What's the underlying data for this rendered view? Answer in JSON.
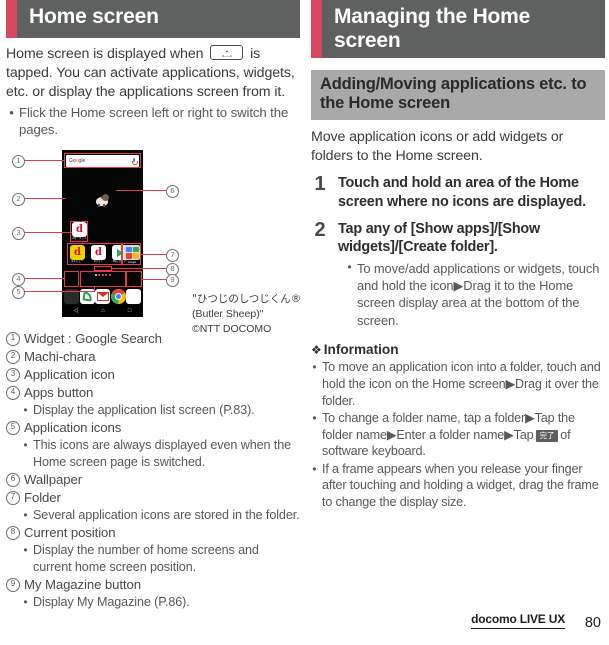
{
  "left": {
    "heading": "Home screen",
    "intro_before_key": "Home screen is displayed when",
    "intro_after_key": "is tapped. You can activate applications, widgets, etc. or display the applications screen from it.",
    "intro_bullet": "Flick the Home screen left or right to switch the pages.",
    "figure": {
      "search_widget_text": "Google",
      "app_icons": [
        {
          "label": "dマーケット",
          "name": "d-market"
        },
        {
          "label": "dメニュー",
          "name": "d-menu"
        },
        {
          "label": "dフォト",
          "name": "d-photo"
        },
        {
          "label": "Play ストア",
          "name": "play-store"
        }
      ],
      "folder_label": "Google",
      "page_dots_total": 5,
      "page_dots_active_index": 0,
      "callout_numbers": [
        "1",
        "2",
        "3",
        "4",
        "5",
        "6",
        "7",
        "8",
        "9"
      ]
    },
    "caption": {
      "line1": "\"ひつじのしつじくん®",
      "line2": "(Butler Sheep)\"",
      "line3": "©NTT DOCOMO"
    },
    "legend": [
      {
        "num": "1",
        "label": "Widget : Google Search",
        "subs": []
      },
      {
        "num": "2",
        "label": "Machi-chara",
        "subs": []
      },
      {
        "num": "3",
        "label": "Application icon",
        "subs": []
      },
      {
        "num": "4",
        "label": "Apps button",
        "subs": [
          "Display the application list screen (P.83)."
        ]
      },
      {
        "num": "5",
        "label": "Application icons",
        "subs": [
          "This icons are always displayed even when the Home screen page is switched."
        ]
      },
      {
        "num": "6",
        "label": "Wallpaper",
        "subs": []
      },
      {
        "num": "7",
        "label": "Folder",
        "subs": [
          "Several application icons are stored in the folder."
        ]
      },
      {
        "num": "8",
        "label": "Current position",
        "subs": [
          "Display the number of home screens and current home screen position."
        ]
      },
      {
        "num": "9",
        "label": "My Magazine button",
        "subs": [
          "Display My Magazine (P.86)."
        ]
      }
    ]
  },
  "right": {
    "heading": "Managing the Home screen",
    "subheading": "Adding/Moving applications etc. to the Home screen",
    "intro": "Move application icons or add widgets or folders to the Home screen.",
    "steps": [
      {
        "num": "1",
        "title": "Touch and hold an area of the Home screen where no icons are displayed.",
        "bullets": []
      },
      {
        "num": "2",
        "title": "Tap any of [Show apps]/[Show widgets]/[Create folder].",
        "bullets": [
          "To move/add applications or widgets, touch and hold the icon▶Drag it to the Home screen display area at the bottom of the screen."
        ]
      }
    ],
    "information_heading": "Information",
    "information_items": [
      {
        "text_1": "To move an application icon into a folder, touch and hold the icon on the Home screen▶Drag it over the folder."
      },
      {
        "text_1": "To change a folder name, tap a folder▶Tap the folder name▶Enter a folder name▶Tap",
        "key": "完了",
        "text_2": "of software keyboard."
      },
      {
        "text_1": "If a frame appears when you release your finger after touching and holding a widget, drag the frame to change the display size."
      }
    ]
  },
  "footer": {
    "brand": "docomo LIVE UX",
    "page_number": "80"
  },
  "colors": {
    "accent": "#d9485e",
    "heading_bg": "#5f6060",
    "subheading_bg": "#a9a9a9",
    "callout_red": "#e8384f"
  }
}
